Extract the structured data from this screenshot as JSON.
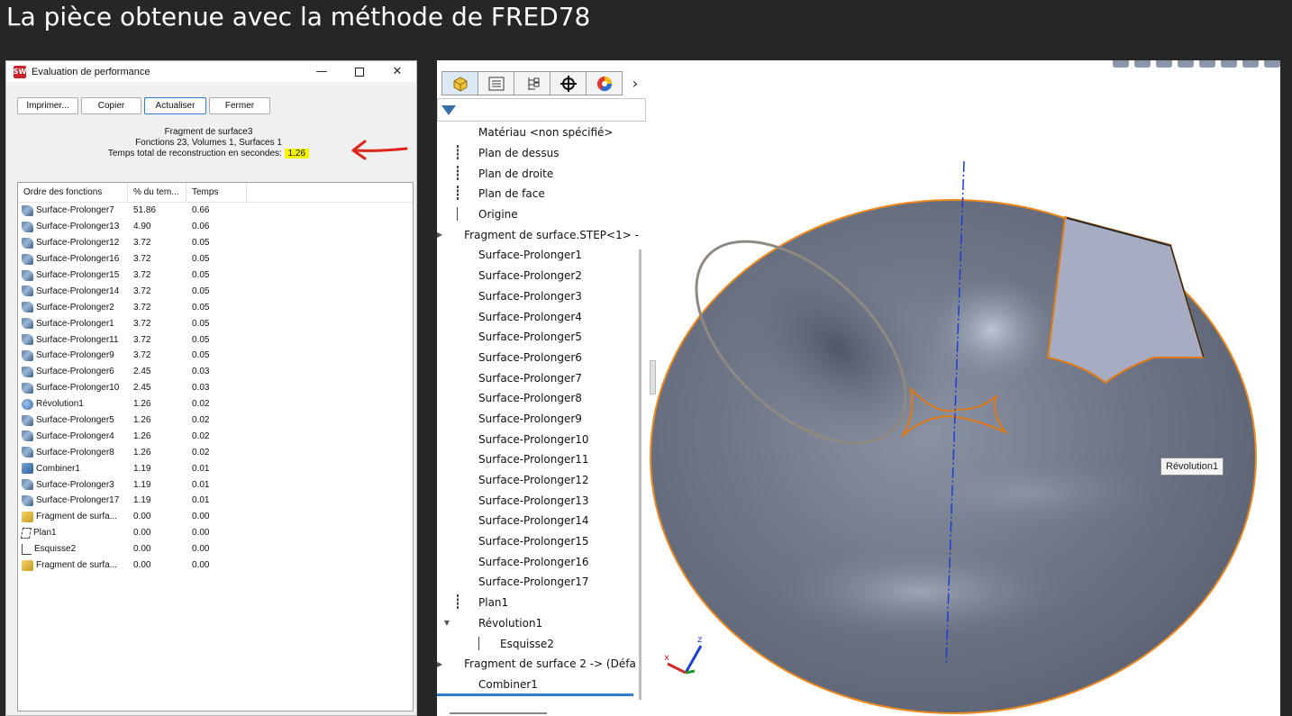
{
  "slide": {
    "title": "La pièce obtenue avec la méthode de FRED78"
  },
  "perf_dialog": {
    "title": "Evaluation de performance",
    "buttons": {
      "print": "Imprimer...",
      "copy": "Copier",
      "refresh": "Actualiser",
      "close": "Fermer"
    },
    "info": {
      "name": "Fragment de surface3",
      "counts": "Fonctions 23, Volumes 1, Surfaces 1",
      "rebuild_label": "Temps total de reconstruction en secondes:",
      "rebuild_value": "1.26"
    },
    "columns": [
      "Ordre des fonctions",
      "% du tem...",
      "Temps"
    ],
    "rows": [
      {
        "icon": "surface-extend-icon",
        "name": "Surface-Prolonger7",
        "pct": "51.86",
        "time": "0.66"
      },
      {
        "icon": "surface-extend-icon",
        "name": "Surface-Prolonger13",
        "pct": "4.90",
        "time": "0.06"
      },
      {
        "icon": "surface-extend-icon",
        "name": "Surface-Prolonger12",
        "pct": "3.72",
        "time": "0.05"
      },
      {
        "icon": "surface-extend-icon",
        "name": "Surface-Prolonger16",
        "pct": "3.72",
        "time": "0.05"
      },
      {
        "icon": "surface-extend-icon",
        "name": "Surface-Prolonger15",
        "pct": "3.72",
        "time": "0.05"
      },
      {
        "icon": "surface-extend-icon",
        "name": "Surface-Prolonger14",
        "pct": "3.72",
        "time": "0.05"
      },
      {
        "icon": "surface-extend-icon",
        "name": "Surface-Prolonger2",
        "pct": "3.72",
        "time": "0.05"
      },
      {
        "icon": "surface-extend-icon",
        "name": "Surface-Prolonger1",
        "pct": "3.72",
        "time": "0.05"
      },
      {
        "icon": "surface-extend-icon",
        "name": "Surface-Prolonger11",
        "pct": "3.72",
        "time": "0.05"
      },
      {
        "icon": "surface-extend-icon",
        "name": "Surface-Prolonger9",
        "pct": "3.72",
        "time": "0.05"
      },
      {
        "icon": "surface-extend-icon",
        "name": "Surface-Prolonger6",
        "pct": "2.45",
        "time": "0.03"
      },
      {
        "icon": "surface-extend-icon",
        "name": "Surface-Prolonger10",
        "pct": "2.45",
        "time": "0.03"
      },
      {
        "icon": "revolve-icon",
        "name": "Révolution1",
        "pct": "1.26",
        "time": "0.02"
      },
      {
        "icon": "surface-extend-icon",
        "name": "Surface-Prolonger5",
        "pct": "1.26",
        "time": "0.02"
      },
      {
        "icon": "surface-extend-icon",
        "name": "Surface-Prolonger4",
        "pct": "1.26",
        "time": "0.02"
      },
      {
        "icon": "surface-extend-icon",
        "name": "Surface-Prolonger8",
        "pct": "1.26",
        "time": "0.02"
      },
      {
        "icon": "combine-icon",
        "name": "Combiner1",
        "pct": "1.19",
        "time": "0.01"
      },
      {
        "icon": "surface-extend-icon",
        "name": "Surface-Prolonger3",
        "pct": "1.19",
        "time": "0.01"
      },
      {
        "icon": "surface-extend-icon",
        "name": "Surface-Prolonger17",
        "pct": "1.19",
        "time": "0.01"
      },
      {
        "icon": "part-fragment-icon",
        "name": "Fragment de surfa...",
        "pct": "0.00",
        "time": "0.00"
      },
      {
        "icon": "plane-icon",
        "name": "Plan1",
        "pct": "0.00",
        "time": "0.00"
      },
      {
        "icon": "sketch-icon",
        "name": "Esquisse2",
        "pct": "0.00",
        "time": "0.00"
      },
      {
        "icon": "part-fragment-icon",
        "name": "Fragment de surfa...",
        "pct": "0.00",
        "time": "0.00"
      }
    ]
  },
  "feature_manager": {
    "tabs": [
      "feature-manager-tab",
      "property-manager-tab",
      "configuration-manager-tab",
      "dimxpert-tab",
      "display-manager-tab"
    ],
    "tree": [
      {
        "icon": "material-icon",
        "label": "Matériau <non spécifié>",
        "expander": "",
        "child": false
      },
      {
        "icon": "plane-icon",
        "label": "Plan de dessus",
        "expander": "",
        "child": false
      },
      {
        "icon": "plane-icon",
        "label": "Plan de droite",
        "expander": "",
        "child": false
      },
      {
        "icon": "plane-icon",
        "label": "Plan de face",
        "expander": "",
        "child": false
      },
      {
        "icon": "origin-icon",
        "label": "Origine",
        "expander": "",
        "child": false
      },
      {
        "icon": "part-fragment-icon",
        "label": "Fragment de surface.STEP<1> -",
        "expander": "▶",
        "child": false
      },
      {
        "icon": "surface-extend-icon",
        "label": "Surface-Prolonger1",
        "expander": "",
        "child": false
      },
      {
        "icon": "surface-extend-icon",
        "label": "Surface-Prolonger2",
        "expander": "",
        "child": false
      },
      {
        "icon": "surface-extend-icon",
        "label": "Surface-Prolonger3",
        "expander": "",
        "child": false
      },
      {
        "icon": "surface-extend-icon",
        "label": "Surface-Prolonger4",
        "expander": "",
        "child": false
      },
      {
        "icon": "surface-extend-icon",
        "label": "Surface-Prolonger5",
        "expander": "",
        "child": false
      },
      {
        "icon": "surface-extend-icon",
        "label": "Surface-Prolonger6",
        "expander": "",
        "child": false
      },
      {
        "icon": "surface-extend-icon",
        "label": "Surface-Prolonger7",
        "expander": "",
        "child": false
      },
      {
        "icon": "surface-extend-icon",
        "label": "Surface-Prolonger8",
        "expander": "",
        "child": false
      },
      {
        "icon": "surface-extend-icon",
        "label": "Surface-Prolonger9",
        "expander": "",
        "child": false
      },
      {
        "icon": "surface-extend-icon",
        "label": "Surface-Prolonger10",
        "expander": "",
        "child": false
      },
      {
        "icon": "surface-extend-icon",
        "label": "Surface-Prolonger11",
        "expander": "",
        "child": false
      },
      {
        "icon": "surface-extend-icon",
        "label": "Surface-Prolonger12",
        "expander": "",
        "child": false
      },
      {
        "icon": "surface-extend-icon",
        "label": "Surface-Prolonger13",
        "expander": "",
        "child": false
      },
      {
        "icon": "surface-extend-icon",
        "label": "Surface-Prolonger14",
        "expander": "",
        "child": false
      },
      {
        "icon": "surface-extend-icon",
        "label": "Surface-Prolonger15",
        "expander": "",
        "child": false
      },
      {
        "icon": "surface-extend-icon",
        "label": "Surface-Prolonger16",
        "expander": "",
        "child": false
      },
      {
        "icon": "surface-extend-icon",
        "label": "Surface-Prolonger17",
        "expander": "",
        "child": false
      },
      {
        "icon": "plane-icon",
        "label": "Plan1",
        "expander": "",
        "child": false
      },
      {
        "icon": "revolve-icon",
        "label": "Révolution1",
        "expander": "▼",
        "child": false
      },
      {
        "icon": "sketch-icon",
        "label": "Esquisse2",
        "expander": "",
        "child": true
      },
      {
        "icon": "part-fragment-icon",
        "label": "Fragment de surface 2 -> (Défa",
        "expander": "▶",
        "child": false
      },
      {
        "icon": "combine-icon",
        "label": "Combiner1",
        "expander": "",
        "child": false
      }
    ]
  },
  "viewport": {
    "tooltip": "Révolution1",
    "triad_x": "x",
    "triad_z": "z"
  },
  "colors": {
    "part_fill": "#6e7687",
    "edge_highlight": "#ef8a1e",
    "axis_line": "#1a3fd0",
    "annotation_arrow": "#e0231b",
    "highlight": "#f5f500"
  }
}
